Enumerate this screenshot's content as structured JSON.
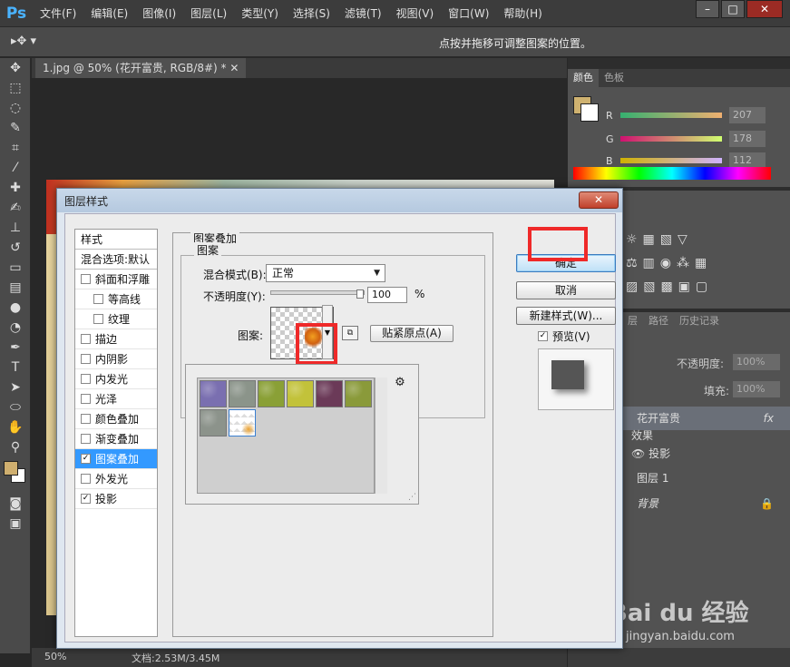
{
  "app": {
    "logo": "Ps",
    "menu": [
      "文件(F)",
      "编辑(E)",
      "图像(I)",
      "图层(L)",
      "类型(Y)",
      "选择(S)",
      "滤镜(T)",
      "视图(V)",
      "窗口(W)",
      "帮助(H)"
    ],
    "hint": "点按并拖移可调整图案的位置。",
    "doc_tab": "1.jpg @ 50% (花开富贵, RGB/8#) *",
    "zoom": "50%",
    "doc_size": "文档:2.53M/3.45M"
  },
  "color_panel": {
    "tabs": [
      "颜色",
      "色板"
    ],
    "r_label": "R",
    "g_label": "G",
    "b_label": "B",
    "r_value": "207",
    "g_value": "178",
    "b_value": "112",
    "fg_color": "#cfb270"
  },
  "layers_panel": {
    "tabs": [
      "层",
      "路径",
      "历史记录"
    ],
    "opacity_label": "不透明度:",
    "opacity_value": "100%",
    "fill_label": "填充:",
    "fill_value": "100%",
    "layers": [
      {
        "name": "花开富贵",
        "badge": "fx"
      },
      {
        "name": "效果"
      },
      {
        "name": "投影"
      },
      {
        "name": "图层 1"
      },
      {
        "name": "背景"
      }
    ]
  },
  "dialog": {
    "title": "图层样式",
    "close_label": "✕",
    "styles_header": "样式",
    "blend_options": "混合选项:默认",
    "styles": [
      {
        "label": "斜面和浮雕",
        "checked": false,
        "indent": false
      },
      {
        "label": "等高线",
        "checked": false,
        "indent": true
      },
      {
        "label": "纹理",
        "checked": false,
        "indent": true
      },
      {
        "label": "描边",
        "checked": false,
        "indent": false
      },
      {
        "label": "内阴影",
        "checked": false,
        "indent": false
      },
      {
        "label": "内发光",
        "checked": false,
        "indent": false
      },
      {
        "label": "光泽",
        "checked": false,
        "indent": false
      },
      {
        "label": "颜色叠加",
        "checked": false,
        "indent": false
      },
      {
        "label": "渐变叠加",
        "checked": false,
        "indent": false
      },
      {
        "label": "图案叠加",
        "checked": true,
        "indent": false,
        "selected": true
      },
      {
        "label": "外发光",
        "checked": false,
        "indent": false
      },
      {
        "label": "投影",
        "checked": true,
        "indent": false
      }
    ],
    "group_title": "图案叠加",
    "sub_title": "图案",
    "blend_mode_label": "混合模式(B):",
    "blend_mode_value": "正常",
    "opacity_label": "不透明度(Y):",
    "opacity_value": "100",
    "opacity_unit": "%",
    "pattern_label": "图案:",
    "snap_button": "贴紧原点(A)",
    "ok_button": "确定",
    "cancel_button": "取消",
    "new_style_button": "新建样式(W)...",
    "preview_label": "预览(V)",
    "preview_checked": true,
    "pattern_tiles": [
      {
        "name": "purple-flowers",
        "color": "#7a6fb0"
      },
      {
        "name": "gray-moss",
        "color": "#8b948a"
      },
      {
        "name": "green-leaves",
        "color": "#8aa036"
      },
      {
        "name": "yellow-leaves",
        "color": "#c2c23a"
      },
      {
        "name": "purple-berries",
        "color": "#6b3a58"
      },
      {
        "name": "olive-grass",
        "color": "#8a9a3a"
      },
      {
        "name": "gray-stone",
        "color": "#8c938b"
      },
      {
        "name": "flower-pattern",
        "color": "#e8a030"
      }
    ]
  },
  "watermark": {
    "brand": "Bai du 经验",
    "url": "jingyan.baidu.com"
  }
}
